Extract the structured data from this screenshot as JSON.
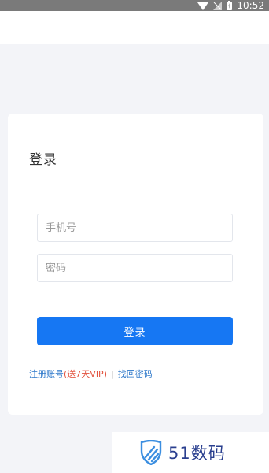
{
  "status_bar": {
    "time": "10:52"
  },
  "login": {
    "title": "登录",
    "phone_placeholder": "手机号",
    "password_placeholder": "密码",
    "submit_label": "登录",
    "register_label": "注册账号",
    "promo_label": "(送7天VIP)",
    "separator": "|",
    "forgot_label": "找回密码"
  },
  "watermark": {
    "text": "51数码"
  },
  "colors": {
    "accent": "#1677f3",
    "link": "#2a76c9",
    "promo": "#e2533f"
  }
}
